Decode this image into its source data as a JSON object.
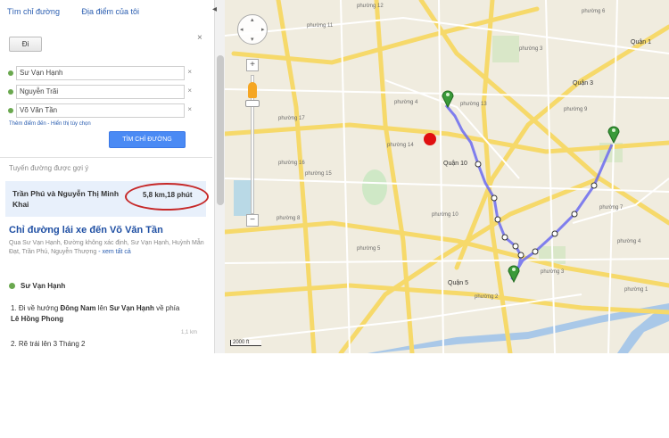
{
  "panel": {
    "tabs": [
      "Tìm chỉ đường",
      "Địa điểm của tôi"
    ],
    "collapse_glyph": "◂",
    "close_glyph": "×",
    "small_button": "Đi",
    "stops": [
      "Sư Vạn Hạnh",
      "Nguyễn Trãi",
      "Võ Văn Tần"
    ],
    "stop_remove_glyph": "×",
    "options_link": "Thêm điểm đến - Hiển thị tùy chọn",
    "find_button": "TÌM CHỈ ĐƯỜNG",
    "suggested_heading": "Tuyến đường được gợi ý",
    "route": {
      "name": "Trần Phú và Nguyễn Thị Minh Khai",
      "distance_time": "5,8 km,18 phút"
    },
    "directions_title": "Chỉ đường lái xe đến Võ Văn Tần",
    "via_text": "Qua Sư Vạn Hạnh, Đường không xác định, Sư Vạn Hạnh, Huỳnh Mẫn Đạt, Trần Phú, Nguyễn Thượng",
    "via_more": "- xem tất cả",
    "start_label": "Sư Vạn Hạnh",
    "step1_prefix": "1. Đi về hướng ",
    "step1_bold1": "Đông Nam",
    "step1_mid": " lên ",
    "step1_bold2": "Sư Vạn Hạnh",
    "step1_mid2": " về phía ",
    "step1_bold3": "Lê Hồng Phong",
    "step1_dist": "1,1 km",
    "step2": "2. Rẽ trái lên 3 Tháng 2"
  },
  "map": {
    "controls": {
      "zoom_in": "+",
      "zoom_out": "−",
      "pan_up": "▴",
      "pan_down": "▾",
      "pan_left": "◂",
      "pan_right": "▸"
    },
    "scale_label": "2000 ft",
    "districts": [
      "Quận 3",
      "Quận 10",
      "Quận 5",
      "Quận 1"
    ],
    "ward_label": "phường",
    "ward_numbers": [
      "12",
      "11",
      "13",
      "14",
      "15",
      "10",
      "6",
      "9",
      "4",
      "7",
      "5",
      "3",
      "8",
      "2",
      "1",
      "16",
      "17",
      "3",
      "4"
    ],
    "route_color": "#6b6bf0",
    "origin_marker_color": "#e01010",
    "waypoint_marker_color": "#3a9a3a"
  },
  "annotation": {
    "highlight_color": "#c62828"
  }
}
